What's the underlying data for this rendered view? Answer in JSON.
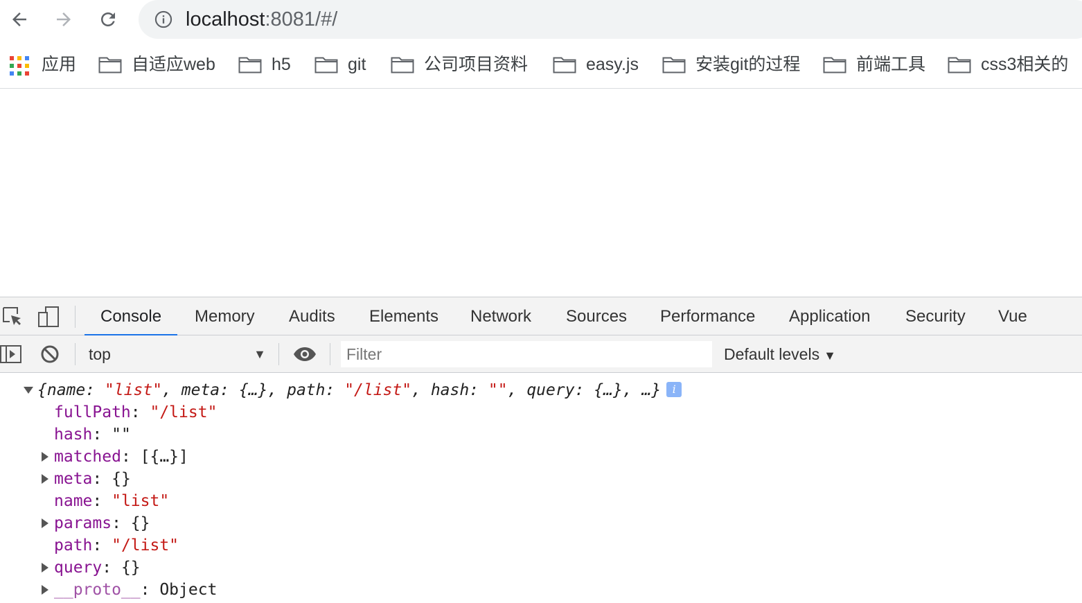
{
  "browser": {
    "url_host": "localhost",
    "url_rest": ":8081/#/",
    "nav": {
      "back_icon": "arrow-left-icon",
      "forward_icon": "arrow-right-icon",
      "reload_icon": "reload-icon",
      "info_icon": "info-circle-icon"
    }
  },
  "bookmarks": [
    {
      "label": "应用",
      "icon": "apps-grid-icon"
    },
    {
      "label": "自适应web",
      "icon": "folder-icon"
    },
    {
      "label": "h5",
      "icon": "folder-icon"
    },
    {
      "label": "git",
      "icon": "folder-icon"
    },
    {
      "label": "公司项目资料",
      "icon": "folder-icon"
    },
    {
      "label": "easy.js",
      "icon": "folder-icon"
    },
    {
      "label": "安装git的过程",
      "icon": "folder-icon"
    },
    {
      "label": "前端工具",
      "icon": "folder-icon"
    },
    {
      "label": "css3相关的",
      "icon": "folder-icon"
    }
  ],
  "devtools": {
    "tabs": [
      "Console",
      "Memory",
      "Audits",
      "Elements",
      "Network",
      "Sources",
      "Performance",
      "Application",
      "Security",
      "Vue"
    ],
    "active_tab": "Console",
    "context": "top",
    "filter_placeholder": "Filter",
    "levels": "Default levels",
    "accent_color": "#1a73e8"
  },
  "console": {
    "summary": {
      "open": "{",
      "k1": "name",
      "v1": "\"list\"",
      "k2": "meta",
      "v2": "{…}",
      "k3": "path",
      "v3": "\"/list\"",
      "k4": "hash",
      "v4": "\"\"",
      "k5": "query",
      "v5": "{…}",
      "tail": "…}",
      "badge": "i"
    },
    "props": [
      {
        "key": "fullPath",
        "value": "\"/list\"",
        "kind": "string",
        "expandable": false
      },
      {
        "key": "hash",
        "value": "\"\"",
        "kind": "plain",
        "expandable": false
      },
      {
        "key": "matched",
        "value": "[{…}]",
        "kind": "plain",
        "expandable": true
      },
      {
        "key": "meta",
        "value": "{}",
        "kind": "plain",
        "expandable": true
      },
      {
        "key": "name",
        "value": "\"list\"",
        "kind": "string",
        "expandable": false
      },
      {
        "key": "params",
        "value": "{}",
        "kind": "plain",
        "expandable": true
      },
      {
        "key": "path",
        "value": "\"/list\"",
        "kind": "string",
        "expandable": false
      },
      {
        "key": "query",
        "value": "{}",
        "kind": "plain",
        "expandable": true
      },
      {
        "key": "__proto__",
        "value": "Object",
        "kind": "plain",
        "expandable": true
      }
    ]
  }
}
